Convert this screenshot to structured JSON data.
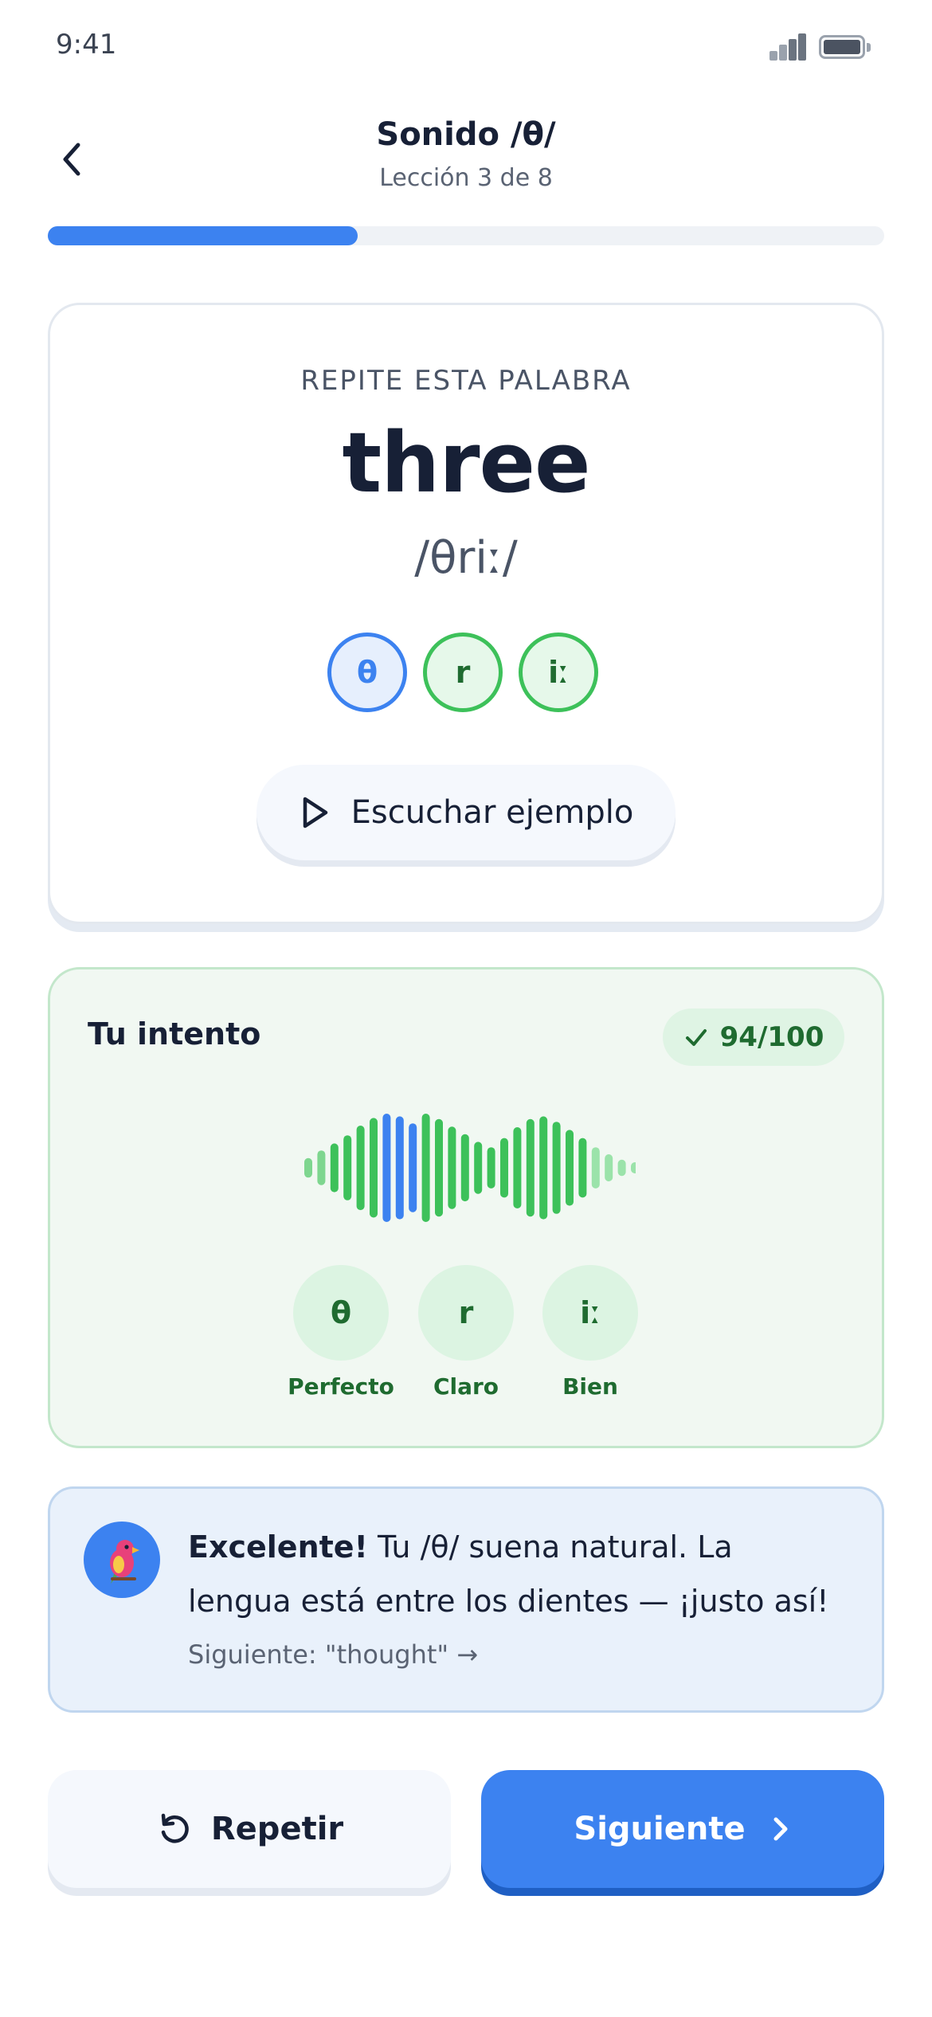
{
  "status_bar": {
    "time": "9:41"
  },
  "header": {
    "title": "Sonido /θ/",
    "subtitle": "Lección 3 de 8",
    "progress": 0.37
  },
  "prompt_card": {
    "eyebrow": "REPITE ESTA PALABRA",
    "word": "three",
    "ipa": "/θriː/",
    "phonemes": [
      "θ",
      "r",
      "iː"
    ],
    "listen_label": "Escuchar ejemplo"
  },
  "attempt": {
    "title": "Tu intento",
    "score": "94/100",
    "waveform_levels": [
      0.18,
      0.32,
      0.45,
      0.6,
      0.78,
      0.92,
      1.0,
      0.95,
      0.82,
      1.0,
      0.9,
      0.76,
      0.62,
      0.48,
      0.38,
      0.55,
      0.75,
      0.9,
      0.95,
      0.85,
      0.7,
      0.55,
      0.38,
      0.25,
      0.15,
      0.1
    ],
    "waveform_highlight": [
      6,
      7,
      8
    ],
    "results": [
      {
        "symbol": "θ",
        "label": "Perfecto"
      },
      {
        "symbol": "r",
        "label": "Claro"
      },
      {
        "symbol": "iː",
        "label": "Bien"
      }
    ]
  },
  "feedback": {
    "headline": "Excelente!",
    "message": " Tu /θ/ suena natural. La lengua está entre los dientes — ¡justo así!",
    "next_hint": "Siguiente: \"thought\" →"
  },
  "actions": {
    "repeat_label": "Repetir",
    "next_label": "Siguiente"
  },
  "colors": {
    "accent": "#3c82f0",
    "success": "#3dc15a",
    "success_dark": "#1f6b30",
    "text": "#172036"
  },
  "icons": [
    "signal-icon",
    "battery-icon",
    "back-chevron-icon",
    "play-icon",
    "check-icon",
    "parrot-icon",
    "replay-icon",
    "chevron-right-icon"
  ]
}
